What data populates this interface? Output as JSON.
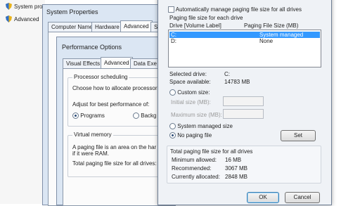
{
  "background_items": [
    {
      "label": "System pro",
      "icon": "shield-icon"
    },
    {
      "label": "Advanced",
      "icon": "shield-icon"
    }
  ],
  "system_properties": {
    "title": "System Properties",
    "tabs": [
      "Computer Name",
      "Hardware",
      "Advanced",
      "Syste"
    ]
  },
  "performance_options": {
    "title": "Performance Options",
    "tabs": [
      "Visual Effects",
      "Advanced",
      "Data Exe"
    ],
    "processor_scheduling": {
      "label": "Processor scheduling",
      "description": "Choose how to allocate processor",
      "adjust_label": "Adjust for best performance of:",
      "programs": "Programs",
      "background": "Backg"
    },
    "virtual_memory": {
      "label": "Virtual memory",
      "desc_line1": "A paging file is an area on the har",
      "desc_line2": "if it were RAM.",
      "total": "Total paging file size for all drives:"
    }
  },
  "virtual_memory_dialog": {
    "auto_manage": "Automatically manage paging file size for all drives",
    "section_label": "Paging file size for each drive",
    "columns": [
      "Drive  [Volume Label]",
      "Paging File Size (MB)"
    ],
    "drives": [
      {
        "drive": "C:",
        "size": "System managed",
        "selected": true
      },
      {
        "drive": "D:",
        "size": "None",
        "selected": false
      }
    ],
    "selected_drive_label": "Selected drive:",
    "selected_drive_value": "C:",
    "space_label": "Space available:",
    "space_value": "14783 MB",
    "custom_size": "Custom size:",
    "initial_label": "Initial size (MB):",
    "maximum_label": "Maximum size (MB):",
    "system_managed": "System managed size",
    "no_paging": "No paging file",
    "set_button": "Set",
    "total_label": "Total paging file size for all drives",
    "min_label": "Minimum allowed:",
    "min_value": "16 MB",
    "rec_label": "Recommended:",
    "rec_value": "3067 MB",
    "cur_label": "Currently allocated:",
    "cur_value": "2848 MB",
    "ok": "OK",
    "cancel": "Cancel"
  }
}
